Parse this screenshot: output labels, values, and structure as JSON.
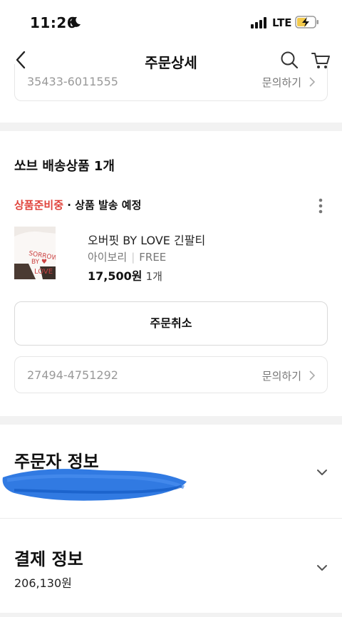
{
  "status_bar": {
    "time": "11:26",
    "network": "LTE"
  },
  "nav": {
    "title": "주문상세"
  },
  "top_partial": {
    "tracking_number": "35433-6011555",
    "inquiry_label": "문의하기"
  },
  "shipment": {
    "title": "쏘브 배송상품 1개",
    "status_label": "상품준비중",
    "status_detail": " · 상품 발송 예정",
    "product": {
      "name": "오버핏 BY LOVE 긴팔티",
      "color": "아이보리",
      "size": "FREE",
      "price": "17,500원",
      "quantity": "1개"
    },
    "cancel_label": "주문취소",
    "tracking_number": "27494-4751292",
    "inquiry_label": "문의하기"
  },
  "orderer": {
    "title": "주문자 정보"
  },
  "payment": {
    "title": "결제 정보",
    "amount": "206,130원"
  },
  "colors": {
    "accent_red": "#e0433b",
    "divider": "#f2f2f2",
    "scribble_blue": "#1f6fe0"
  }
}
